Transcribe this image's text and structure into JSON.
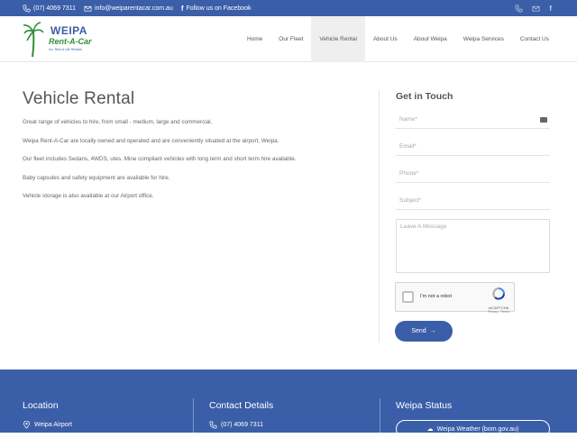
{
  "topbar": {
    "phone": "(07) 4069 7311",
    "email": "info@weiparentacar.com.au",
    "facebook": "Follow us on Facebook"
  },
  "logo": {
    "line1": "WEIPA",
    "line2": "Rent-A-Car",
    "tagline": "Inc. Rent & Ute Rentals"
  },
  "nav": {
    "items": [
      "Home",
      "Our Fleet",
      "Vehicle Rental",
      "About Us",
      "About Weipa",
      "Weipa Services",
      "Contact Us"
    ],
    "active": "Vehicle Rental"
  },
  "main": {
    "title": "Vehicle Rental",
    "paragraphs": [
      "Great range of vehicles to hire, from small - medium, large and commercial.",
      "Weipa Rent-A-Car are locally owned and operated and are conveniently situated at the airport, Weipa.",
      "Our fleet includes Sedans, 4WDS, utes. Mine compliant vehicles with long term and short term hire available.",
      "Baby capsules and safety equipment are available for hire.",
      "Vehicle storage is also available at our Airport office."
    ]
  },
  "contact_form": {
    "title": "Get in Touch",
    "name_placeholder": "Name*",
    "email_placeholder": "Email*",
    "phone_placeholder": "Phone*",
    "subject_placeholder": "Subject*",
    "message_placeholder": "Leave A Message",
    "captcha_label": "I'm not a robot",
    "captcha_brand": "reCAPTCHA",
    "captcha_terms": "Privacy - Terms",
    "send_label": "Send"
  },
  "footer": {
    "location_title": "Location",
    "location_line": "Weipa Airport",
    "contact_title": "Contact Details",
    "contact_phone": "(07) 4069 7311",
    "status_title": "Weipa Status",
    "weather_label": "Weipa Weather (bom.gov.au)"
  },
  "colors": {
    "brand_blue": "#3a5ea8",
    "logo_green": "#2f8f3a"
  }
}
